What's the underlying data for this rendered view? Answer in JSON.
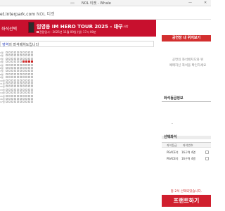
{
  "window": {
    "title": "NOL 티켓 - Whale",
    "minimize": "—",
    "close": "✕"
  },
  "address_bar": {
    "url": "et.interpark.com",
    "site_name": "NOL 티켓"
  },
  "event_header": {
    "step_label": "좌석선택",
    "title": "임영웅 IM HERO TOUR 2025 - 대구",
    "change_link": "| 게시 사항",
    "date": "관람일시 : 2025년 11월 09일 (일) 17시 00분"
  },
  "seat_area": {
    "prefix": "영역",
    "message": "의 좌석배치도입니다",
    "row_labels": [
      "1열",
      "2열",
      "3열",
      "4열",
      "5열",
      "6열",
      "7열",
      "8열",
      "9열",
      "10열",
      "11열",
      "12열",
      "13열",
      "14열",
      "15열",
      "16열",
      "17열"
    ],
    "seats_per_row": 10,
    "selected_seats": [
      {
        "row": 3,
        "col": 6
      },
      {
        "row": 3,
        "col": 7
      },
      {
        "row": 3,
        "col": 8
      },
      {
        "row": 3,
        "col": 9
      }
    ]
  },
  "right_panel": {
    "header": "공연장 내 위치보기",
    "empty_line1": "공연의 좌석배치도와 위",
    "empty_line2": "예매하신 좌석을 확인하세요",
    "grade_title": "좌석등급정보",
    "grade_dash": "-",
    "selected_title": "선택좌석",
    "col_grade": "좌석등급",
    "col_seat": "좌석번호",
    "seats": [
      {
        "grade": "PEACE석",
        "seat": "16구역 4열"
      },
      {
        "grade": "PEACE석",
        "seat": "16구역 4열"
      }
    ],
    "count_text": "총 2석 선택되었습니다.",
    "ticket_button": "프랜트하기"
  }
}
